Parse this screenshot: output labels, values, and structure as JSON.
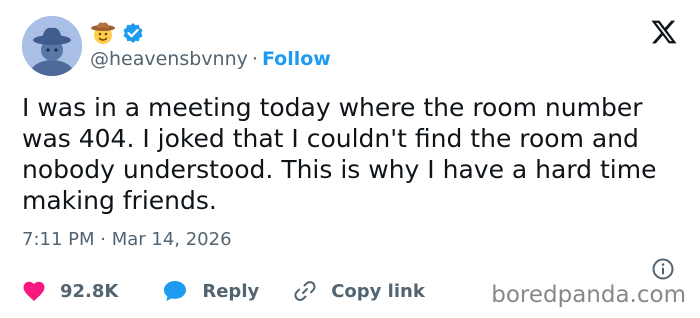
{
  "profile": {
    "handle": "@heavensbvnny",
    "separator": "·",
    "follow_label": "Follow"
  },
  "icons": {
    "avatar": "cowboy-avatar",
    "hat_emoji": "cowboy-hat-face-icon",
    "verified": "verified-badge-icon",
    "platform": "x-logo-icon",
    "info": "info-icon",
    "like": "heart-icon",
    "reply": "speech-bubble-icon",
    "copy": "link-icon"
  },
  "tweet": {
    "text": "I was in a meeting today where the room number\nwas 404. I joked that I couldn't find the room and\nnobody understood. This is why I have a hard time\nmaking friends.",
    "timestamp": "7:11 PM · Mar 14, 2026"
  },
  "actions": {
    "like_count": "92.8K",
    "reply_label": "Reply",
    "copy_label": "Copy link"
  },
  "watermark": "boredpanda.com",
  "colors": {
    "accent": "#1d9bf0",
    "like": "#f91880",
    "muted": "#536471",
    "text": "#0f1419"
  }
}
